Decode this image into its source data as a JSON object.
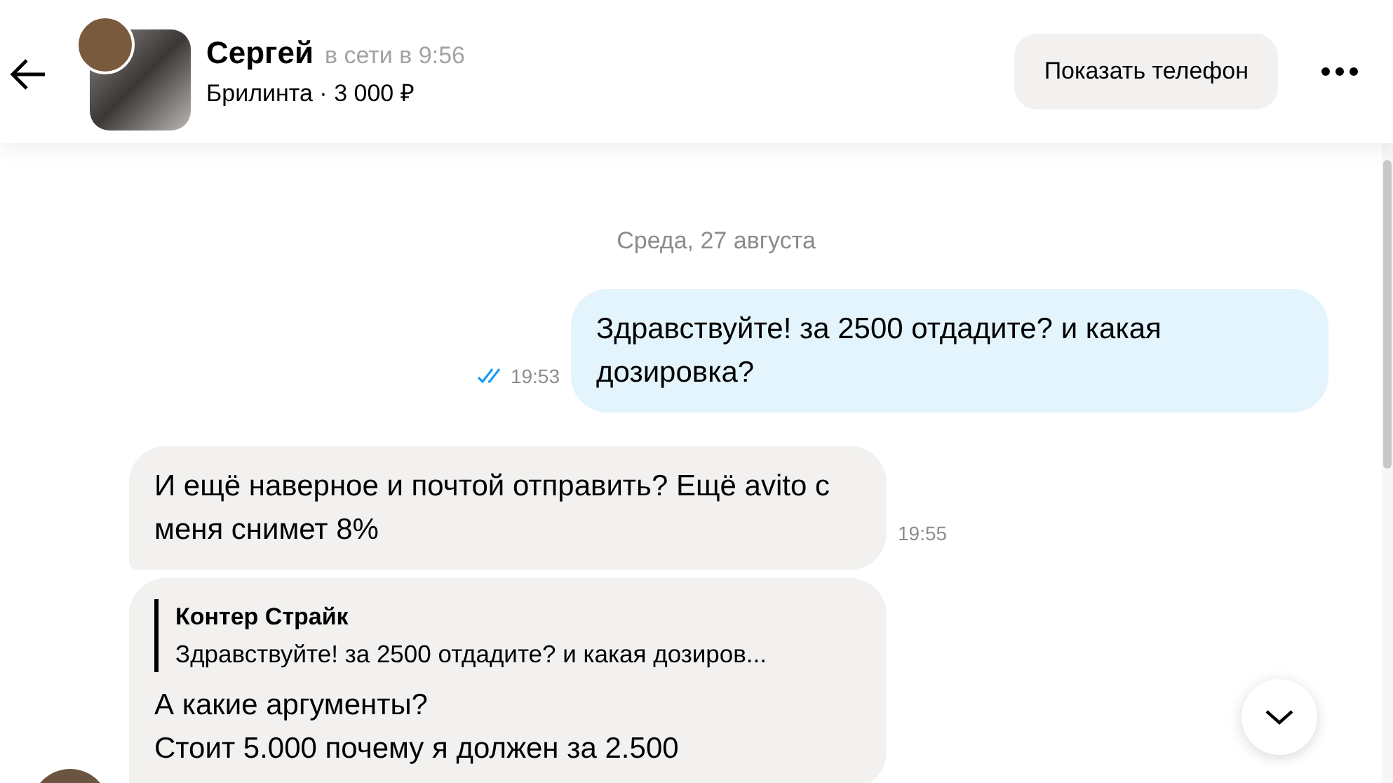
{
  "header": {
    "name": "Сергей",
    "status": "в сети в 9:56",
    "listing": "Брилинта · 3 000 ₽",
    "phone_button": "Показать телефон"
  },
  "date_separator": "Среда, 27 августа",
  "messages": [
    {
      "kind": "outgoing",
      "text": "Здравствуйте! за 2500 отдадите? и какая дозировка?",
      "time": "19:53",
      "read": true
    },
    {
      "kind": "incoming",
      "text": "И ещё наверное и почтой отправить? Ещё avito с меня снимет 8%",
      "time": "19:55"
    },
    {
      "kind": "incoming",
      "quote": {
        "author": "Контер Страйк",
        "text": "Здравствуйте! за 2500 отдадите? и какая дозиров..."
      },
      "text": "А какие аргументы?\nСтоит 5.000 почему я должен за 2.500"
    }
  ]
}
